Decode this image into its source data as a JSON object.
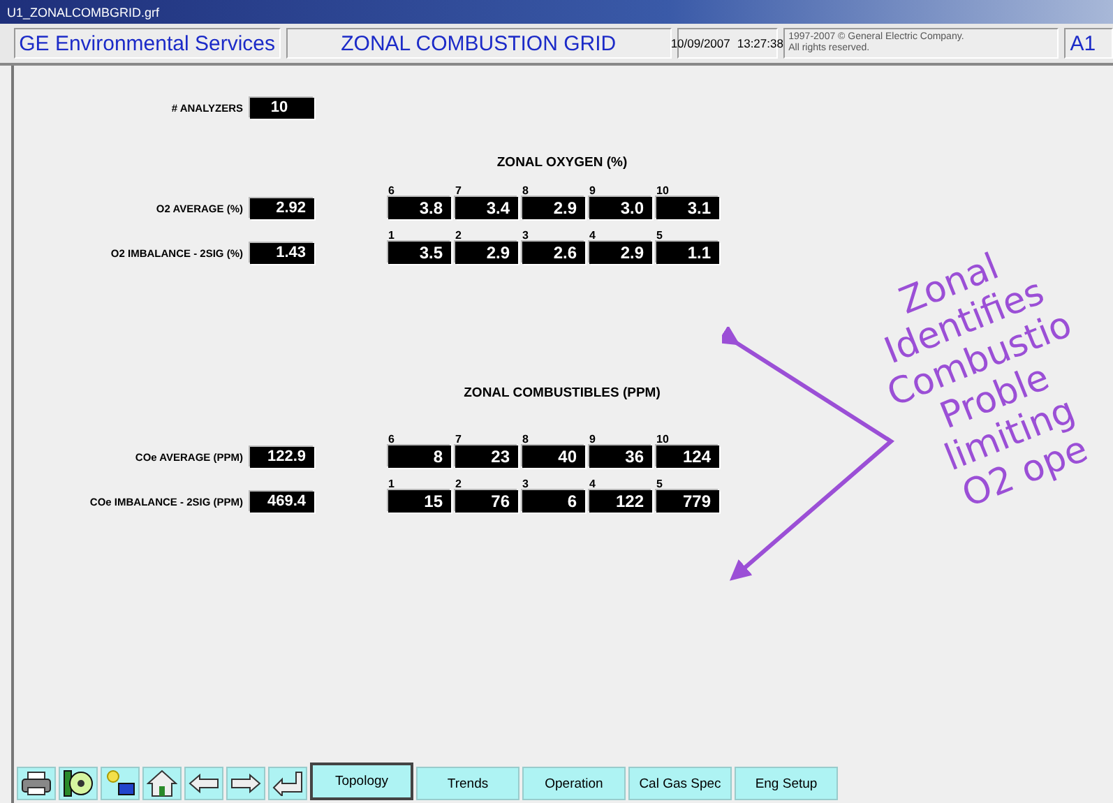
{
  "window": {
    "title": "U1_ZONALCOMBGRID.grf"
  },
  "header": {
    "company": "GE Environmental Services",
    "title": "ZONAL COMBUSTION GRID",
    "date": "10/09/2007",
    "time": "13:27:38",
    "copyright": [
      "1997-2007 © General Electric Company.",
      "All rights reserved."
    ],
    "unit": "A1"
  },
  "analyzers": {
    "label": "# ANALYZERS",
    "value": "10"
  },
  "sections": [
    {
      "heading": "ZONAL OXYGEN (%)",
      "rows": [
        {
          "label": "O2 AVERAGE (%)",
          "value": "2.92",
          "zones": [
            {
              "number": "6",
              "value": "3.8"
            },
            {
              "number": "7",
              "value": "3.4"
            },
            {
              "number": "8",
              "value": "2.9"
            },
            {
              "number": "9",
              "value": "3.0"
            },
            {
              "number": "10",
              "value": "3.1"
            }
          ]
        },
        {
          "label": "O2 IMBALANCE - 2SIG (%)",
          "value": "1.43",
          "zones": [
            {
              "number": "1",
              "value": "3.5"
            },
            {
              "number": "2",
              "value": "2.9"
            },
            {
              "number": "3",
              "value": "2.6"
            },
            {
              "number": "4",
              "value": "2.9"
            },
            {
              "number": "5",
              "value": "1.1"
            }
          ]
        }
      ]
    },
    {
      "heading": "ZONAL COMBUSTIBLES (PPM)",
      "rows": [
        {
          "label": "COe AVERAGE (PPM)",
          "value": "122.9",
          "zones": [
            {
              "number": "6",
              "value": "8"
            },
            {
              "number": "7",
              "value": "23"
            },
            {
              "number": "8",
              "value": "40"
            },
            {
              "number": "9",
              "value": "36"
            },
            {
              "number": "10",
              "value": "124"
            }
          ]
        },
        {
          "label": "COe IMBALANCE - 2SIG (PPM)",
          "value": "469.4",
          "zones": [
            {
              "number": "1",
              "value": "15"
            },
            {
              "number": "2",
              "value": "76"
            },
            {
              "number": "3",
              "value": "6"
            },
            {
              "number": "4",
              "value": "122"
            },
            {
              "number": "5",
              "value": "779"
            }
          ]
        }
      ]
    }
  ],
  "annotation": {
    "lines": [
      "Zonal",
      "Identifies",
      "Combustio",
      "Proble",
      "limiting",
      "O2 ope"
    ]
  },
  "toolbar": {
    "tabs": [
      {
        "label": "Topology",
        "selected": true
      },
      {
        "label": "Trends",
        "selected": false
      },
      {
        "label": "Operation",
        "selected": false
      },
      {
        "label": "Cal Gas Spec",
        "selected": false
      },
      {
        "label": "Eng Setup",
        "selected": false
      }
    ]
  }
}
